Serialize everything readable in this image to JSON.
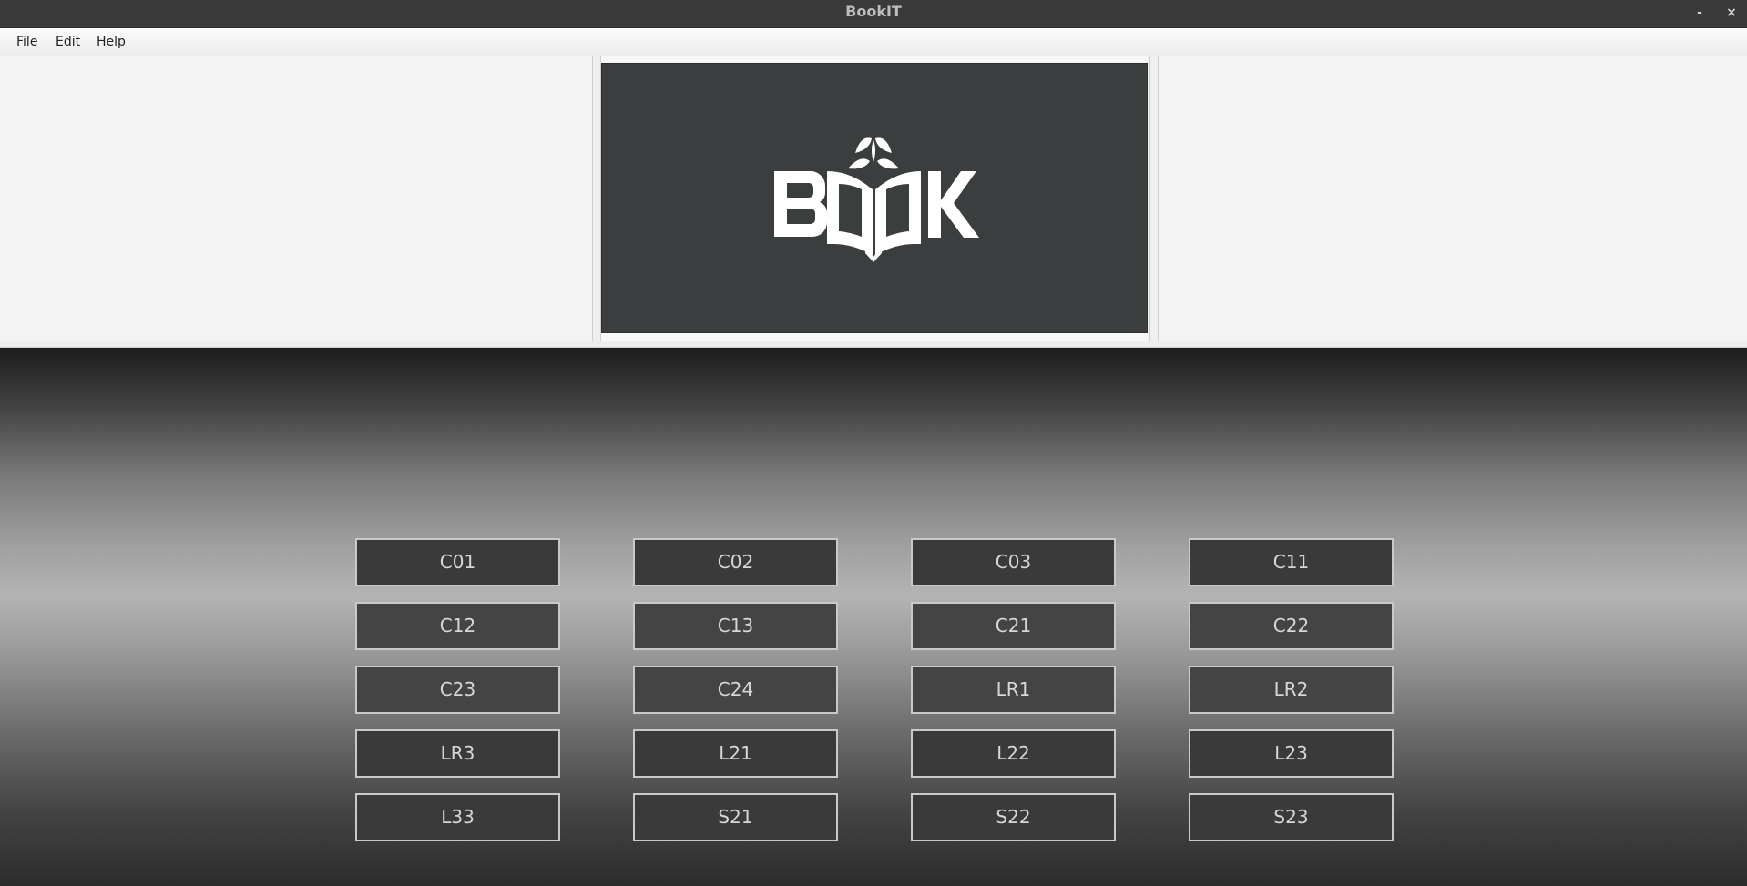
{
  "window": {
    "title": "BookIT",
    "minimize_label": "-",
    "close_label": "×"
  },
  "menu": {
    "items": [
      {
        "label": "File"
      },
      {
        "label": "Edit"
      },
      {
        "label": "Help"
      }
    ]
  },
  "header": {
    "logo_text": "BOOK",
    "logo_background": "#3b3e3e",
    "logo_foreground": "#ffffff"
  },
  "rooms": {
    "buttons": [
      "C01",
      "C02",
      "C03",
      "C11",
      "C12",
      "C13",
      "C21",
      "C22",
      "C23",
      "C24",
      "LR1",
      "LR2",
      "LR3",
      "L21",
      "L22",
      "L23",
      "L33",
      "S21",
      "S22",
      "S23"
    ]
  },
  "colors": {
    "button_border": "#c9c9c9",
    "button_text": "#d7d7d7"
  }
}
